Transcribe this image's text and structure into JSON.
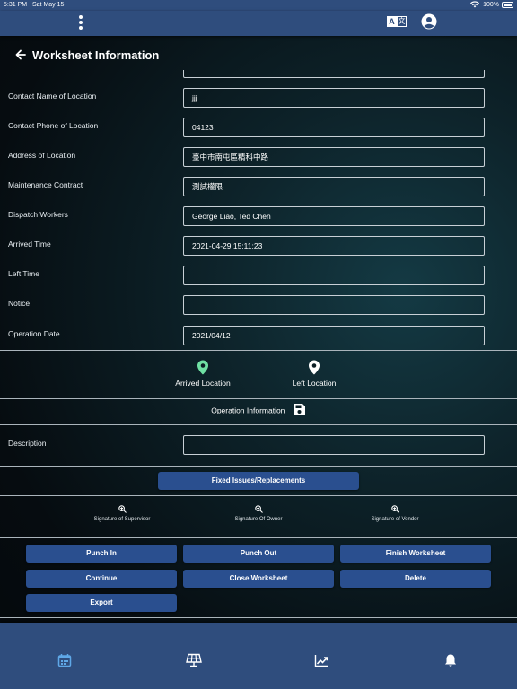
{
  "status_bar": {
    "time": "5:31 PM",
    "date": "Sat May 15",
    "battery": "100%"
  },
  "top_nav": {
    "menu_icon": "more-vertical-icon",
    "translate_icon": "translate-icon",
    "translate_glyph_a": "A",
    "translate_glyph_b": "文",
    "account_icon": "account-circle-icon"
  },
  "page": {
    "title": "Worksheet Information",
    "back_icon": "arrow-left-icon"
  },
  "fields": [
    {
      "label": "Contact Name of Location",
      "value": "jjj"
    },
    {
      "label": "Contact Phone of Location",
      "value": "04123"
    },
    {
      "label": "Address of Location",
      "value": "臺中市南屯區精科中路"
    },
    {
      "label": "Maintenance Contract",
      "value": "測試權限"
    },
    {
      "label": "Dispatch Workers",
      "value": "George Liao, Ted Chen"
    },
    {
      "label": "Arrived Time",
      "value": "2021-04-29 15:11:23"
    },
    {
      "label": "Left Time",
      "value": ""
    },
    {
      "label": "Notice",
      "value": ""
    },
    {
      "label": "Operation Date",
      "value": "2021/04/12"
    }
  ],
  "locations": {
    "arrived": {
      "label": "Arrived Location",
      "icon": "map-pin-icon",
      "color": "#6fe0a3"
    },
    "left": {
      "label": "Left Location",
      "icon": "map-pin-icon",
      "color": "#ffffff"
    }
  },
  "operation_info": {
    "label": "Operation Information",
    "icon": "save-icon"
  },
  "description": {
    "label": "Description",
    "value": ""
  },
  "fixed_issues_button": "Fixed Issues/Replacements",
  "signatures": [
    {
      "label": "Signature of Supervisor",
      "icon": "zoom-in-icon"
    },
    {
      "label": "Signature Of Owner",
      "icon": "zoom-in-icon"
    },
    {
      "label": "Signature of Vendor",
      "icon": "zoom-in-icon"
    }
  ],
  "actions": {
    "punch_in": "Punch In",
    "punch_out": "Punch Out",
    "finish_worksheet": "Finish Worksheet",
    "continue": "Continue",
    "close_worksheet": "Close Worksheet",
    "delete": "Delete",
    "export": "Export"
  },
  "bottom_nav": [
    {
      "name": "calendar",
      "icon": "calendar-icon",
      "active": true
    },
    {
      "name": "solar-panel",
      "icon": "solar-panel-icon",
      "active": false
    },
    {
      "name": "chart",
      "icon": "trending-up-icon",
      "active": false
    },
    {
      "name": "notifications",
      "icon": "bell-icon",
      "active": false
    }
  ],
  "colors": {
    "nav_background": "#2f4d7d",
    "button_background": "#2a4f8f",
    "active_nav_icon": "#5fa8e8",
    "arrived_pin": "#6fe0a3"
  }
}
